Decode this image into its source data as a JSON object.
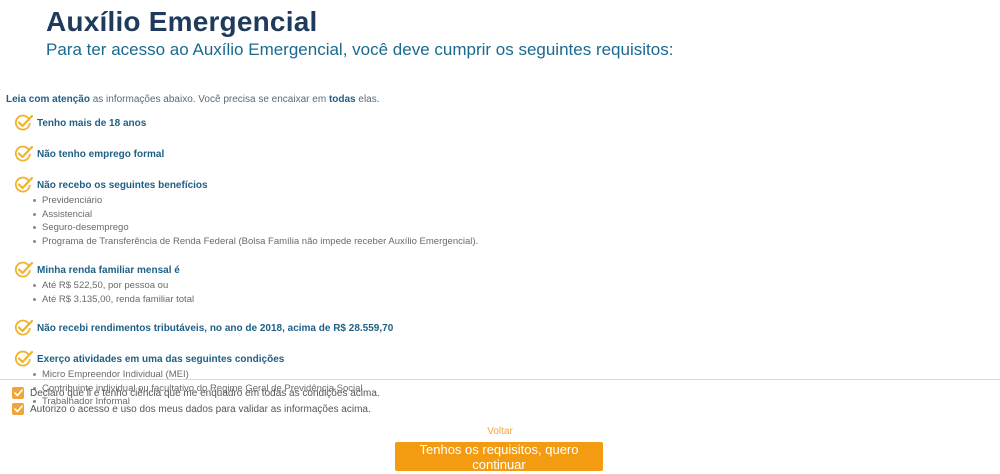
{
  "header": {
    "title": "Auxílio Emergencial",
    "subtitle": "Para ter acesso ao Auxílio Emergencial, você deve cumprir os seguintes requisitos:"
  },
  "intro": {
    "bold1": "Leia com atenção",
    "text1": " as informações abaixo. Você precisa se encaixar em ",
    "bold2": "todas",
    "text2": " elas."
  },
  "requirements": [
    {
      "title": "Tenho mais de 18 anos",
      "items": []
    },
    {
      "title": "Não tenho emprego formal",
      "items": []
    },
    {
      "title": "Não recebo os seguintes benefícios",
      "items": [
        "Previdenciário",
        "Assistencial",
        "Seguro-desemprego",
        "Programa de Transferência de Renda Federal (Bolsa Família não impede receber Auxílio Emergencial)."
      ]
    },
    {
      "title": "Minha renda familiar mensal é",
      "items": [
        "Até R$ 522,50, por pessoa ou",
        "Até R$ 3.135,00, renda familiar total"
      ]
    },
    {
      "title": "Não recebi rendimentos tributáveis, no ano de 2018, acima de R$ 28.559,70",
      "items": []
    },
    {
      "title": "Exerço atividades em uma das seguintes condições",
      "items": [
        "Micro Empreendor Individual (MEI)",
        "Contribuinte individual ou facultativo do Regime Geral de Previdência Social",
        "Trabalhador Informal"
      ]
    }
  ],
  "consents": [
    {
      "label": "Declaro que li e tenho ciência que me enquadro em todas as condições acima.",
      "checked": true
    },
    {
      "label": "Autorizo o acesso e uso dos meus dados para validar as informações acima.",
      "checked": true
    }
  ],
  "actions": {
    "back_label": "Voltar",
    "continue_label": "Tenhos os requisitos, quero continuar"
  },
  "colors": {
    "accent": "#f39c12",
    "title": "#1f3b5c",
    "subtitle": "#1a6a8f",
    "check": "#f0b429"
  },
  "icons": {
    "requirement": "check-circle-icon",
    "consent": "checkbox-checked-icon"
  }
}
